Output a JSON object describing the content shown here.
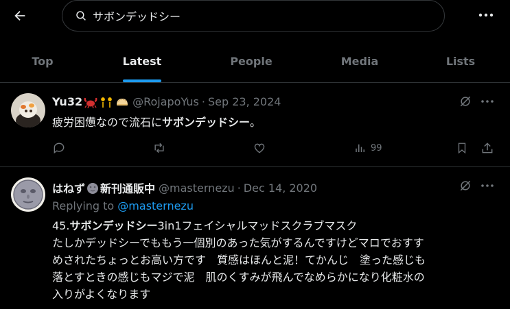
{
  "search": {
    "query": "サボンデッドシー"
  },
  "tabs": [
    {
      "label": "Top"
    },
    {
      "label": "Latest"
    },
    {
      "label": "People"
    },
    {
      "label": "Media"
    },
    {
      "label": "Lists"
    }
  ],
  "tweet1": {
    "name": "Yu32",
    "handle": "@RojapoYus",
    "dot": "·",
    "date": "Sep 23, 2024",
    "text_plain": "疲労困憊なので流石に",
    "text_bold": "サボンデッドシー",
    "text_end": "。",
    "views": "99",
    "emojis": [
      "crab-emoji",
      "fireworks-emoji",
      "dumpling-emoji"
    ]
  },
  "tweet2": {
    "name_a": "はねず",
    "name_b": "新刊通販中",
    "handle": "@masternezu",
    "dot": "·",
    "date": "Dec 14, 2020",
    "replying_prefix": "Replying to ",
    "replying_handle": "@masternezu",
    "line1_a": "45.",
    "line1_bold": "サボンデッドシー",
    "line1_b": "3in1フェイシャルマッドスクラブマスク",
    "line2": "たしかデッドシーでももう一個別のあった気がするんですけどマロでおすす",
    "line3": "めされたちょっとお高い方です　質感はほんと泥！てかんじ　塗った感じも",
    "line4": "落とすときの感じもマジで泥　肌のくすみが飛んでなめらかになり化粧水の",
    "line5": "入りがよくなります"
  },
  "colors": {
    "accent": "#1d9bf0",
    "muted": "#71767b",
    "text": "#e7e9ea",
    "border": "#2f3336"
  }
}
